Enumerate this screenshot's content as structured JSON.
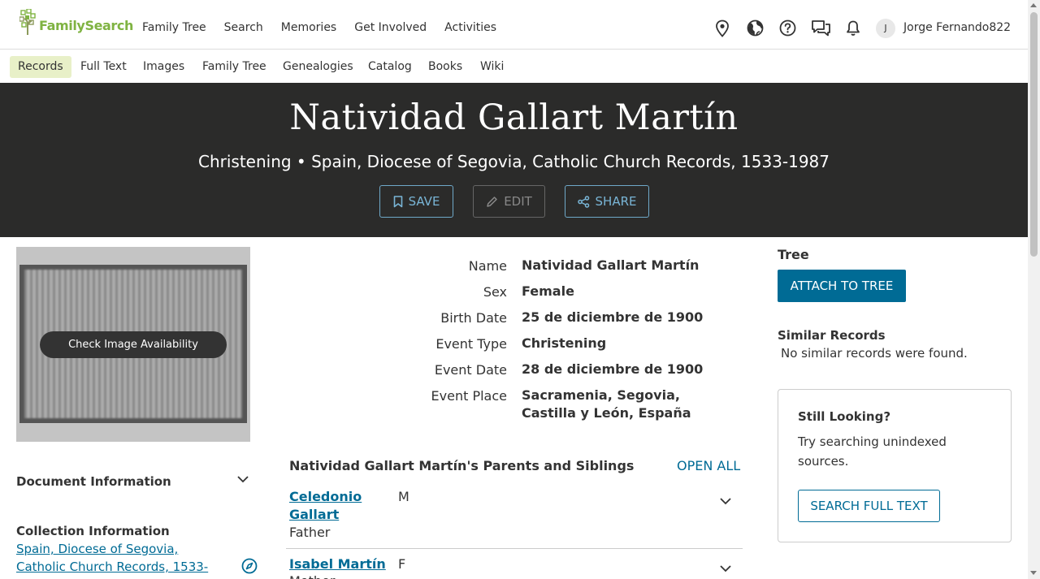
{
  "brand": {
    "name": "FamilySearch",
    "color": "#7fb342"
  },
  "nav": {
    "main": [
      "Family Tree",
      "Search",
      "Memories",
      "Get Involved",
      "Activities"
    ],
    "icons": [
      "location-pin-icon",
      "globe-icon",
      "help-icon",
      "chat-icon",
      "bell-icon"
    ],
    "avatar_initial": "J",
    "username": "Jorge Fernando822"
  },
  "subnav": {
    "items": [
      "Records",
      "Full Text",
      "Images",
      "Family Tree",
      "Genealogies",
      "Catalog",
      "Books",
      "Wiki"
    ],
    "active": "Records"
  },
  "hero": {
    "title": "Natividad Gallart Martín",
    "subtitle": "Christening • Spain, Diocese of Segovia, Catholic Church Records, 1533-1987",
    "save_label": "SAVE",
    "edit_label": "EDIT",
    "share_label": "SHARE"
  },
  "image": {
    "button_label": "Check Image Availability"
  },
  "sidebar": {
    "document_info": "Document Information",
    "collection_title": "Collection Information",
    "collection_link": "Spain, Diocese of Segovia, Catholic Church Records, 1533-"
  },
  "details": [
    {
      "label": "Name",
      "value": "Natividad Gallart Martín"
    },
    {
      "label": "Sex",
      "value": "Female"
    },
    {
      "label": "Birth Date",
      "value": "25 de diciembre de 1900"
    },
    {
      "label": "Event Type",
      "value": "Christening"
    },
    {
      "label": "Event Date",
      "value": "28 de diciembre de 1900"
    },
    {
      "label": "Event Place",
      "value": "Sacramenia, Segovia, Castilla y León, España"
    }
  ],
  "parents": {
    "title": "Natividad Gallart Martín's Parents and Siblings",
    "open_all": "OPEN ALL",
    "people": [
      {
        "name": "Celedonio Gallart",
        "sex": "M",
        "role": "Father"
      },
      {
        "name": "Isabel Martín",
        "sex": "F",
        "role": "Mother"
      }
    ]
  },
  "tree": {
    "title": "Tree",
    "attach_label": "ATTACH TO TREE"
  },
  "similar": {
    "title": "Similar Records",
    "text": "No similar records were found."
  },
  "still_looking": {
    "title": "Still Looking?",
    "text": "Try searching unindexed sources.",
    "button_label": "SEARCH FULL TEXT"
  },
  "colors": {
    "link": "#006b95",
    "hero_bg": "#2b2b2a",
    "active_tab_bg": "#e8f0c8"
  }
}
